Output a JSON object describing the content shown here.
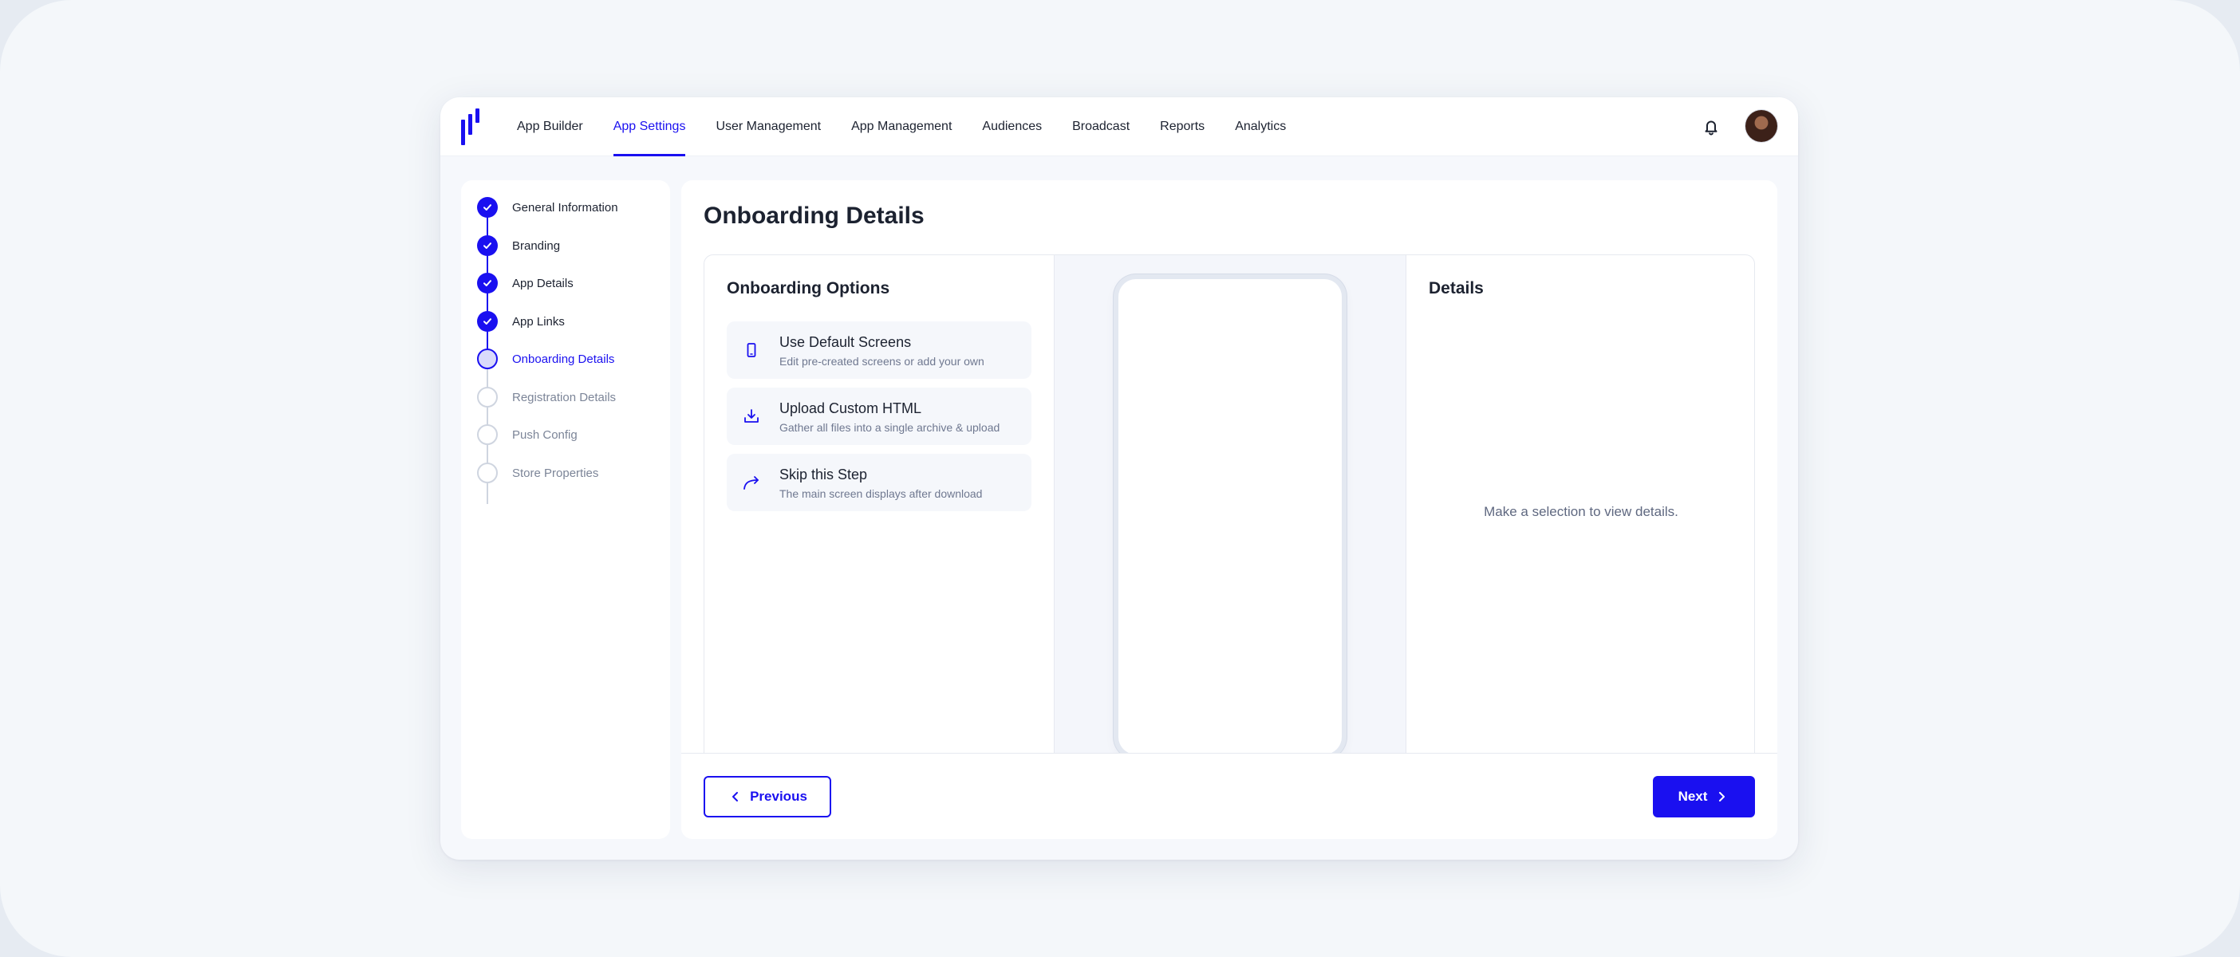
{
  "nav": {
    "items": [
      {
        "label": "App Builder",
        "active": false
      },
      {
        "label": "App Settings",
        "active": true
      },
      {
        "label": "User Management",
        "active": false
      },
      {
        "label": "App Management",
        "active": false
      },
      {
        "label": "Audiences",
        "active": false
      },
      {
        "label": "Broadcast",
        "active": false
      },
      {
        "label": "Reports",
        "active": false
      },
      {
        "label": "Analytics",
        "active": false
      }
    ],
    "notifications_icon": "bell-icon",
    "avatar_icon": "user-avatar"
  },
  "steps": [
    {
      "label": "General Information",
      "status": "completed"
    },
    {
      "label": "Branding",
      "status": "completed"
    },
    {
      "label": "App Details",
      "status": "completed"
    },
    {
      "label": "App Links",
      "status": "completed"
    },
    {
      "label": "Onboarding Details",
      "status": "current"
    },
    {
      "label": "Registration Details",
      "status": "upcoming"
    },
    {
      "label": "Push Config",
      "status": "upcoming"
    },
    {
      "label": "Store Properties",
      "status": "upcoming"
    }
  ],
  "page": {
    "title": "Onboarding Details"
  },
  "options": {
    "heading": "Onboarding Options",
    "items": [
      {
        "title": "Use Default Screens",
        "description": "Edit pre-created screens or add your own",
        "icon": "phone-icon"
      },
      {
        "title": "Upload Custom HTML",
        "description": "Gather all files into a single archive & upload",
        "icon": "download-icon"
      },
      {
        "title": "Skip this Step",
        "description": "The main screen displays after download",
        "icon": "skip-arrow-icon"
      }
    ]
  },
  "details": {
    "heading": "Details",
    "empty_message": "Make a selection to view details."
  },
  "footer": {
    "previous_label": "Previous",
    "next_label": "Next"
  },
  "colors": {
    "accent": "#1a10f0",
    "page_background": "#f4f7fa",
    "text_primary": "#1c2230",
    "text_muted": "#6f7890"
  }
}
